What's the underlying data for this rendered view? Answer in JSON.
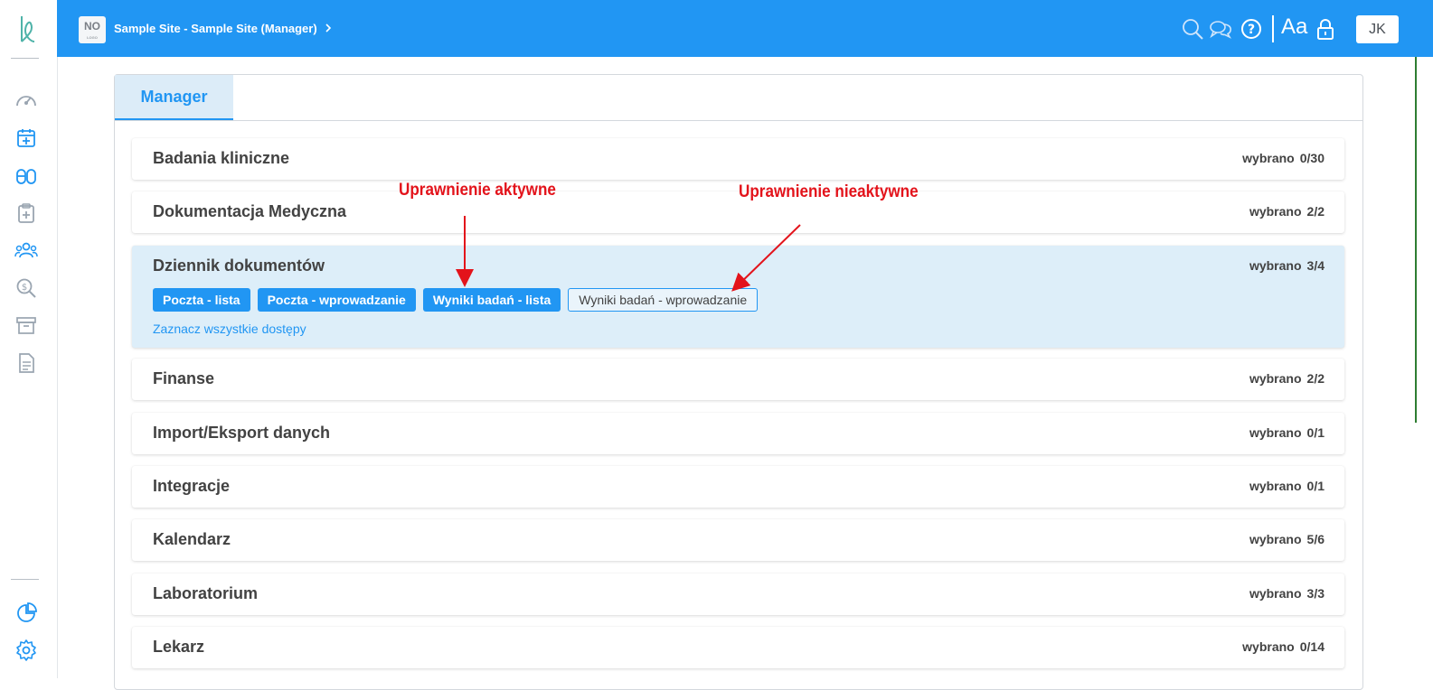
{
  "topbar": {
    "site_badge": "NO",
    "site_badge_sub": "LOGO",
    "site_title": "Sample Site - Sample Site (Manager)",
    "font_toggle": "Aa",
    "user_initials": "JK"
  },
  "tabs": [
    {
      "label": "Manager",
      "active": true
    }
  ],
  "categories": [
    {
      "title": "Badania kliniczne",
      "count_label": "wybrano",
      "count": "0/30"
    },
    {
      "title": "Dokumentacja Medyczna",
      "count_label": "wybrano",
      "count": "2/2"
    },
    {
      "title": "Dziennik dokumentów",
      "count_label": "wybrano",
      "count": "3/4",
      "expanded": true,
      "permissions": [
        {
          "label": "Poczta - lista",
          "active": true
        },
        {
          "label": "Poczta - wprowadzanie",
          "active": true
        },
        {
          "label": "Wyniki badań - lista",
          "active": true
        },
        {
          "label": "Wyniki badań - wprowadzanie",
          "active": false
        }
      ],
      "select_all": "Zaznacz wszystkie dostępy"
    },
    {
      "title": "Finanse",
      "count_label": "wybrano",
      "count": "2/2"
    },
    {
      "title": "Import/Eksport danych",
      "count_label": "wybrano",
      "count": "0/1"
    },
    {
      "title": "Integracje",
      "count_label": "wybrano",
      "count": "0/1"
    },
    {
      "title": "Kalendarz",
      "count_label": "wybrano",
      "count": "5/6"
    },
    {
      "title": "Laboratorium",
      "count_label": "wybrano",
      "count": "3/3"
    },
    {
      "title": "Lekarz",
      "count_label": "wybrano",
      "count": "0/14"
    }
  ],
  "annotations": {
    "active": "Uprawnienie aktywne",
    "inactive": "Uprawnienie nieaktywne"
  },
  "colors": {
    "primary": "#2196f3",
    "expanded_bg": "#ddeef9",
    "annotation": "#e3131b"
  },
  "icons": {
    "sidebar": [
      "logo-icon",
      "dashboard-icon",
      "calendar-add-icon",
      "medications-icon",
      "clipboard-medical-icon",
      "patients-icon",
      "billing-search-icon",
      "archive-icon",
      "document-icon",
      "reports-chart-icon",
      "settings-gear-icon"
    ],
    "topbar": [
      "search-icon",
      "chat-icon",
      "help-icon",
      "lock-icon"
    ]
  }
}
